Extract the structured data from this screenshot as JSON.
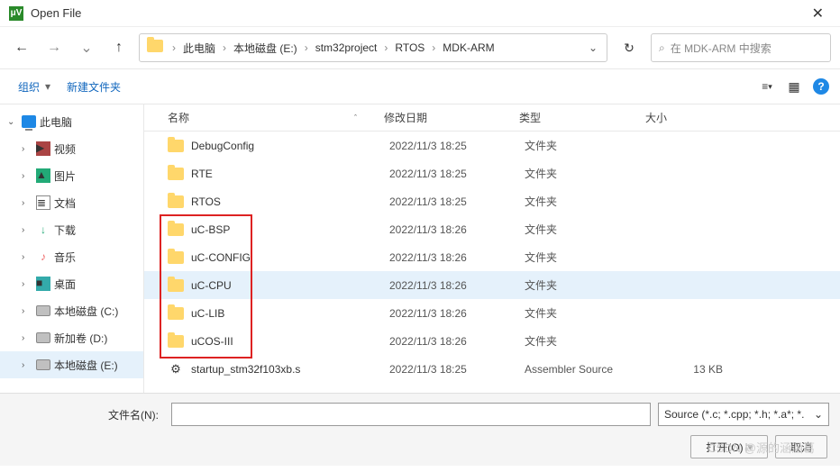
{
  "window": {
    "title": "Open File",
    "close": "✕"
  },
  "nav": {
    "back": "←",
    "forward": "→",
    "up": "↑",
    "reload": "↻",
    "expand": "⌄"
  },
  "breadcrumb": [
    "此电脑",
    "本地磁盘 (E:)",
    "stm32project",
    "RTOS",
    "MDK-ARM"
  ],
  "search": {
    "placeholder": "在 MDK-ARM 中搜索",
    "icon": "⌕"
  },
  "toolbar": {
    "organise": "组织",
    "newFolder": "新建文件夹",
    "view_list": "≡",
    "view_tile": "▦",
    "help": "?"
  },
  "sidebar": [
    {
      "label": "此电脑",
      "icon": "pc",
      "root": true,
      "expanded": true
    },
    {
      "label": "视频",
      "icon": "video"
    },
    {
      "label": "图片",
      "icon": "pic"
    },
    {
      "label": "文档",
      "icon": "doc"
    },
    {
      "label": "下载",
      "icon": "dl"
    },
    {
      "label": "音乐",
      "icon": "music"
    },
    {
      "label": "桌面",
      "icon": "desk"
    },
    {
      "label": "本地磁盘 (C:)",
      "icon": "disk"
    },
    {
      "label": "新加卷 (D:)",
      "icon": "disk"
    },
    {
      "label": "本地磁盘 (E:)",
      "icon": "disk",
      "active": true
    }
  ],
  "columns": {
    "name": "名称",
    "date": "修改日期",
    "type": "类型",
    "size": "大小",
    "sort": "ˆ"
  },
  "files": [
    {
      "name": "DebugConfig",
      "date": "2022/11/3 18:25",
      "type": "文件夹",
      "size": "",
      "kind": "folder"
    },
    {
      "name": "RTE",
      "date": "2022/11/3 18:25",
      "type": "文件夹",
      "size": "",
      "kind": "folder"
    },
    {
      "name": "RTOS",
      "date": "2022/11/3 18:25",
      "type": "文件夹",
      "size": "",
      "kind": "folder"
    },
    {
      "name": "uC-BSP",
      "date": "2022/11/3 18:26",
      "type": "文件夹",
      "size": "",
      "kind": "folder",
      "boxed": true
    },
    {
      "name": "uC-CONFIG",
      "date": "2022/11/3 18:26",
      "type": "文件夹",
      "size": "",
      "kind": "folder",
      "boxed": true
    },
    {
      "name": "uC-CPU",
      "date": "2022/11/3 18:26",
      "type": "文件夹",
      "size": "",
      "kind": "folder",
      "boxed": true,
      "selected": true
    },
    {
      "name": "uC-LIB",
      "date": "2022/11/3 18:26",
      "type": "文件夹",
      "size": "",
      "kind": "folder",
      "boxed": true
    },
    {
      "name": "uCOS-III",
      "date": "2022/11/3 18:26",
      "type": "文件夹",
      "size": "",
      "kind": "folder",
      "boxed": true
    },
    {
      "name": "startup_stm32f103xb.s",
      "date": "2022/11/3 18:25",
      "type": "Assembler Source",
      "size": "13 KB",
      "kind": "asm"
    }
  ],
  "footer": {
    "fileNameLabel": "文件名(N):",
    "fileName": "",
    "fileType": "Source (*.c; *.cpp; *.h; *.a*; *.",
    "open": "打开(O)",
    "cancel": "取消"
  },
  "watermark": "CSDN @源的涵涵葛",
  "colors": {
    "accent": "#1e88e5",
    "folder": "#ffd76b",
    "highlight": "#e5f1fb",
    "annot": "#d22"
  }
}
